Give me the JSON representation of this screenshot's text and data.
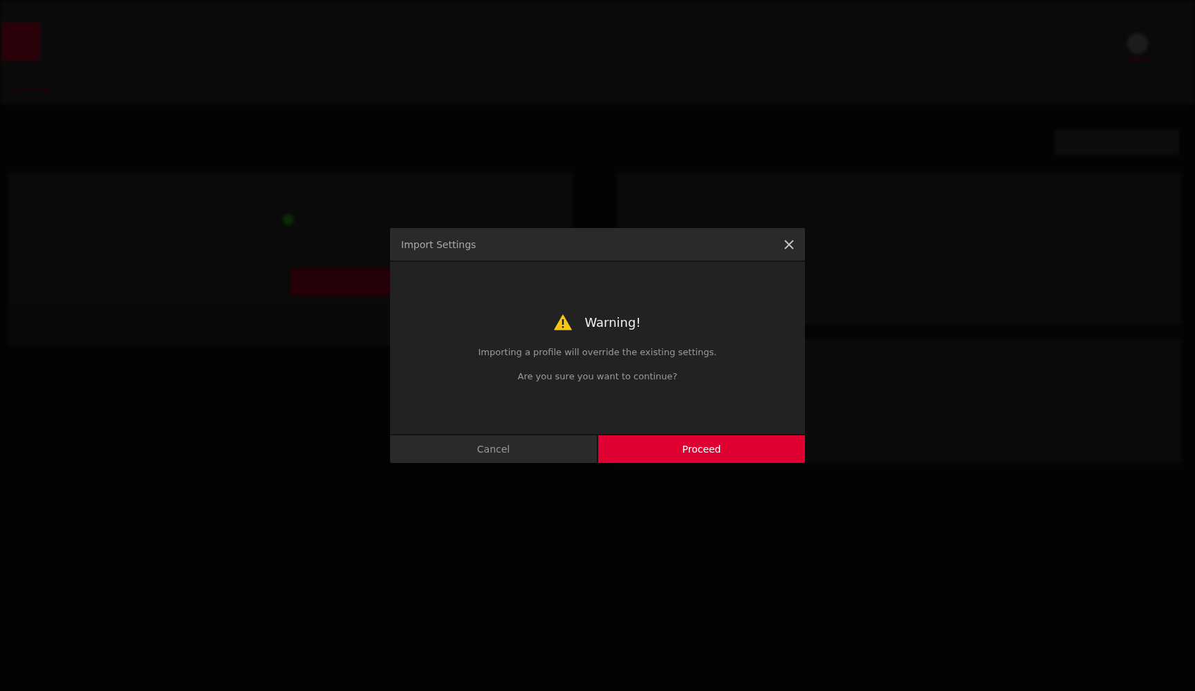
{
  "dialog": {
    "title": "Import Settings",
    "heading": "Warning!",
    "messages": [
      "Importing a profile will override the existing settings.",
      "Are you sure you want to continue?"
    ],
    "buttons": [
      {
        "label": "Cancel",
        "kind": "secondary"
      },
      {
        "label": "Proceed",
        "kind": "primary"
      }
    ]
  }
}
